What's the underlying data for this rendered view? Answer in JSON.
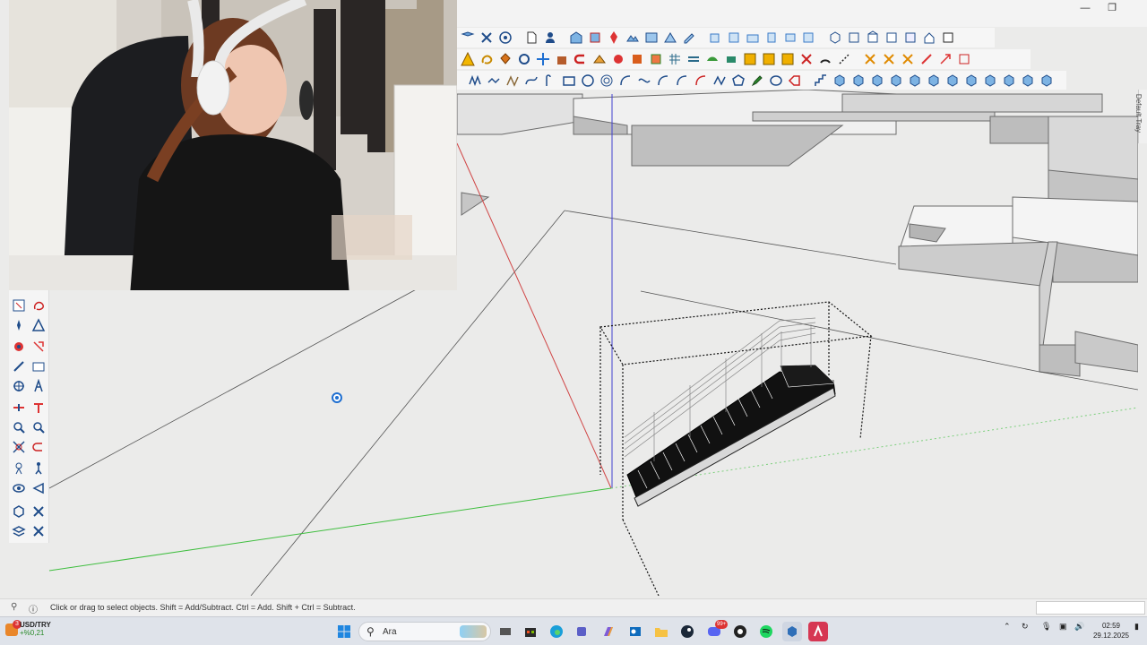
{
  "window": {
    "minimize_icon": "minimize-icon",
    "restore_icon": "restore-icon"
  },
  "toolbars": {
    "row1_count": 28,
    "row2_count": 30,
    "row3_count": 30
  },
  "tray": {
    "default_tray_label": "Default Tray"
  },
  "statusbar": {
    "hint": "Click or drag to select objects. Shift = Add/Subtract. Ctrl = Add. Shift + Ctrl = Subtract."
  },
  "taskbar": {
    "ticker_symbol": "USD/TRY",
    "ticker_change": "+%0,21",
    "ticker_badge": "3",
    "search_placeholder": "Ara",
    "clock_time": "02:59",
    "clock_date": "29.12.2025",
    "discord_badge": "99+",
    "apps": [
      "windows-start",
      "search",
      "widgets",
      "task-view",
      "file-explorer-folder",
      "edge",
      "teams",
      "copilot",
      "outlook",
      "explorer",
      "steam",
      "discord",
      "chrome",
      "spotify",
      "sketchup",
      "app-red"
    ]
  },
  "colors": {
    "accent_blue": "#1f6fd1",
    "axis_red": "#d04545",
    "axis_green": "#3fbe3f",
    "axis_blue": "#4040d0",
    "viewport_bg": "#ebebea"
  }
}
